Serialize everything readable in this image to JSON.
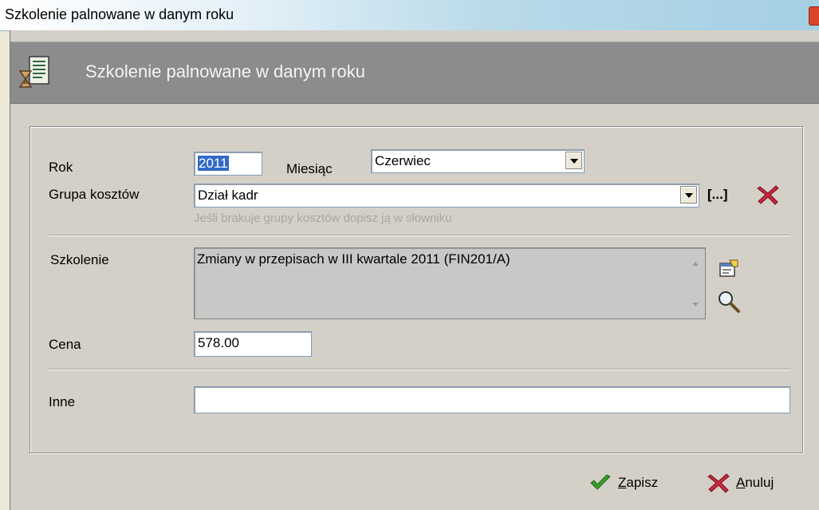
{
  "window": {
    "title": "Szkolenie palnowane w danym roku"
  },
  "header": {
    "title": "Szkolenie palnowane w danym roku"
  },
  "form": {
    "rok_label": "Rok",
    "rok_value": "2011",
    "miesiac_label": "Miesiąc",
    "miesiac_value": "Czerwiec",
    "grupa_label": "Grupa kosztów",
    "grupa_value": "Dział kadr",
    "grupa_browse": "[...]",
    "grupa_hint": "Jeśli brakuje grupy kosztów dopisz ją w słowniku",
    "szkolenie_label": "Szkolenie",
    "szkolenie_value": "Zmiany w przepisach w III kwartale 2011 (FIN201/A)",
    "cena_label": "Cena",
    "cena_value": "578.00",
    "inne_label": "Inne",
    "inne_value": ""
  },
  "buttons": {
    "save_hotkey": "Z",
    "save_rest": "apisz",
    "cancel_hotkey": "A",
    "cancel_rest": "nuluj"
  },
  "icons": {
    "header": "document-hourglass-icon",
    "browse": "ellipsis-browse",
    "clear": "red-x-icon",
    "edit": "properties-icon",
    "search": "magnifier-icon",
    "save": "green-checkmark-icon",
    "cancel": "red-x-icon"
  },
  "colors": {
    "accent_red": "#c8283c",
    "accent_green": "#3aa02a",
    "selection": "#316ac5"
  }
}
